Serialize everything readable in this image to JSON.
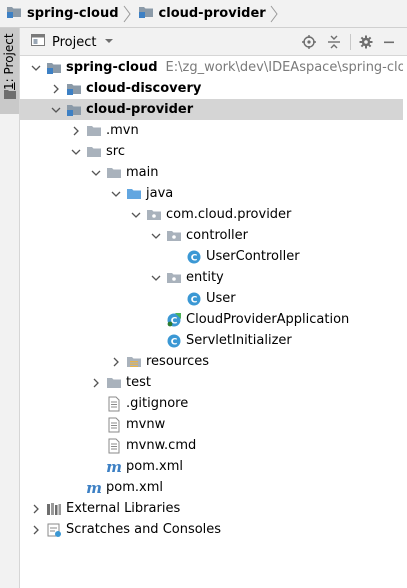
{
  "breadcrumb": [
    {
      "label": "spring-cloud"
    },
    {
      "label": "cloud-provider"
    }
  ],
  "side_strip": {
    "number": "1",
    "label": ": Project"
  },
  "panel": {
    "title": "Project"
  },
  "tree": [
    {
      "label": "spring-cloud",
      "extra": "E:\\zg_work\\dev\\IDEAspace\\spring-cloud",
      "type": "module-root",
      "expanded": true,
      "depth": 0,
      "bold": true
    },
    {
      "label": "cloud-discovery",
      "type": "module",
      "expanded": false,
      "depth": 1,
      "bold": true
    },
    {
      "label": "cloud-provider",
      "type": "module",
      "expanded": true,
      "depth": 1,
      "bold": true,
      "selected": true
    },
    {
      "label": ".mvn",
      "type": "folder",
      "expanded": false,
      "depth": 2
    },
    {
      "label": "src",
      "type": "folder",
      "expanded": true,
      "depth": 2
    },
    {
      "label": "main",
      "type": "folder",
      "expanded": true,
      "depth": 3
    },
    {
      "label": "java",
      "type": "source-folder",
      "expanded": true,
      "depth": 4
    },
    {
      "label": "com.cloud.provider",
      "type": "package",
      "expanded": true,
      "depth": 5
    },
    {
      "label": "controller",
      "type": "package",
      "expanded": true,
      "depth": 6
    },
    {
      "label": "UserController",
      "type": "class",
      "depth": 7
    },
    {
      "label": "entity",
      "type": "package",
      "expanded": true,
      "depth": 6
    },
    {
      "label": "User",
      "type": "class",
      "depth": 7
    },
    {
      "label": "CloudProviderApplication",
      "type": "spring-class",
      "depth": 6
    },
    {
      "label": "ServletInitializer",
      "type": "class",
      "depth": 6
    },
    {
      "label": "resources",
      "type": "resources",
      "expanded": false,
      "depth": 4
    },
    {
      "label": "test",
      "type": "folder",
      "expanded": false,
      "depth": 3
    },
    {
      "label": ".gitignore",
      "type": "file",
      "depth": 3
    },
    {
      "label": "mvnw",
      "type": "file",
      "depth": 3
    },
    {
      "label": "mvnw.cmd",
      "type": "file",
      "depth": 3
    },
    {
      "label": "pom.xml",
      "type": "maven",
      "depth": 3
    },
    {
      "label": "pom.xml",
      "type": "maven",
      "depth": 2
    },
    {
      "label": "External Libraries",
      "type": "libraries",
      "expanded": false,
      "depth": 0
    },
    {
      "label": "Scratches and Consoles",
      "type": "scratches",
      "expanded": false,
      "depth": 0
    }
  ],
  "colors": {
    "folder": "#a9b2bc",
    "module_folder": "#8b9aa8",
    "source_folder": "#62a6e0",
    "class_circle": "#3b98d4",
    "maven": "#3d80c4",
    "selection": "#d5d5d5"
  }
}
